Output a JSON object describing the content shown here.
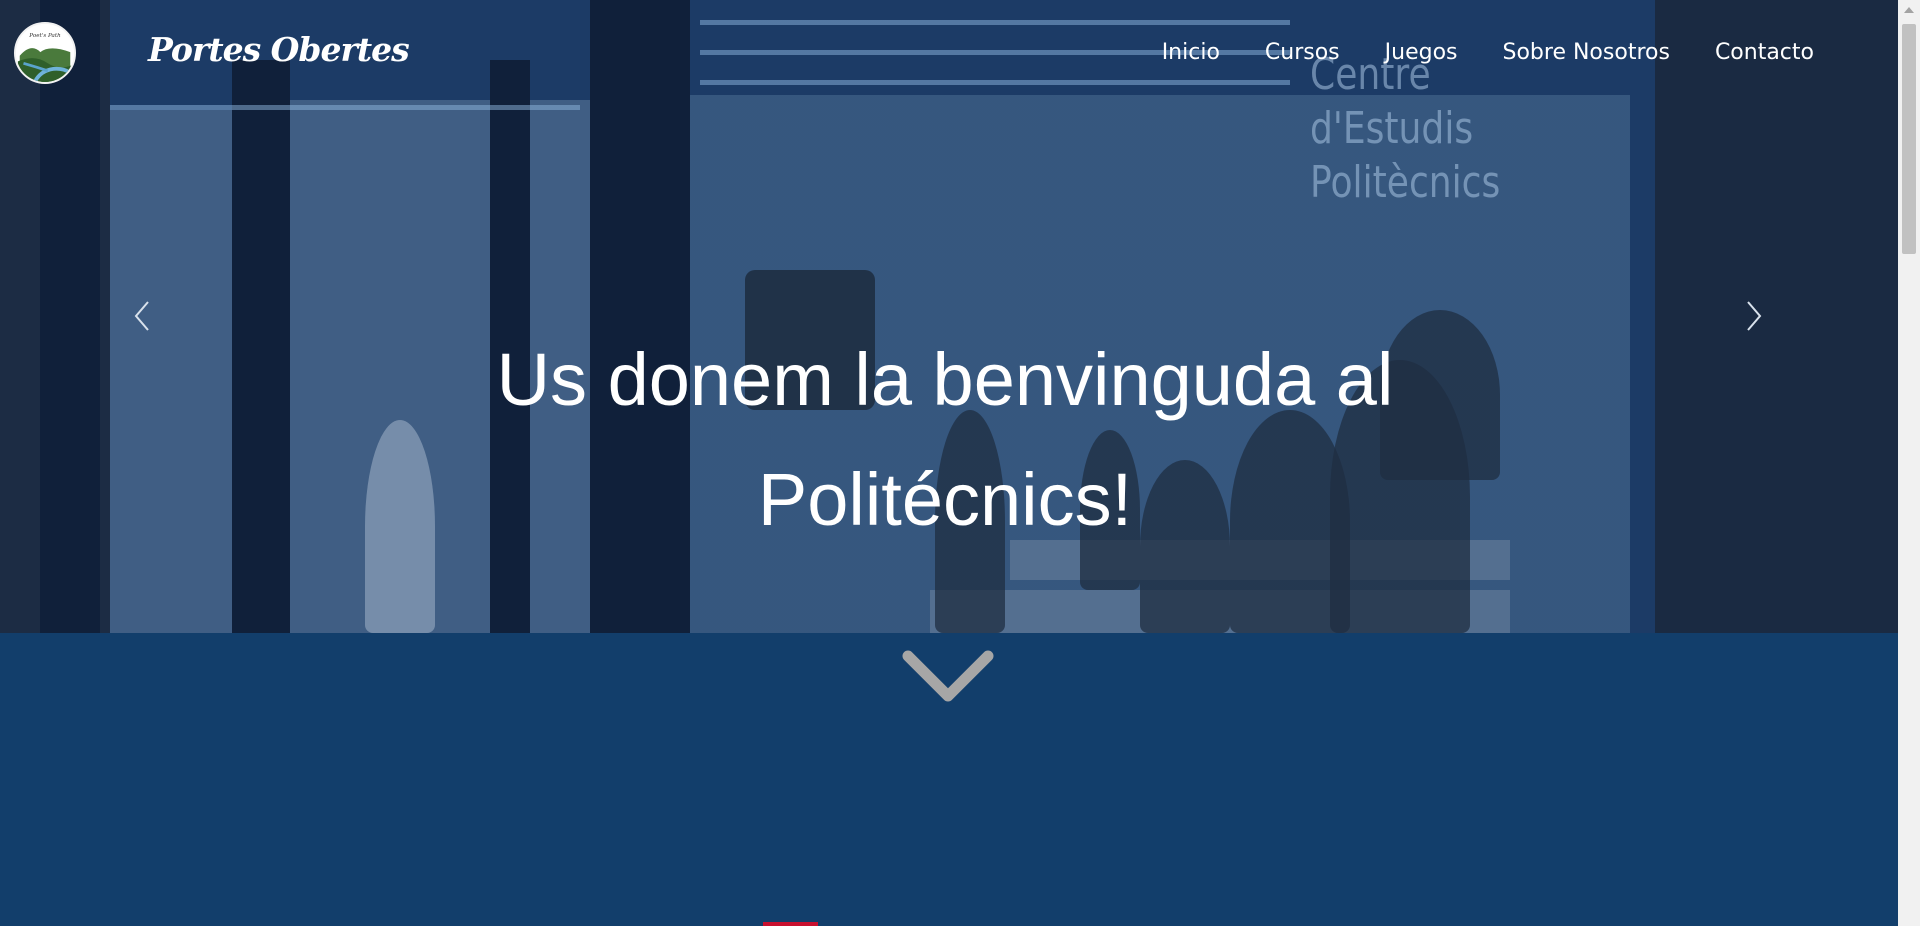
{
  "brand": {
    "name": "Portes Obertes",
    "logo_text": "Poet's Path"
  },
  "nav": {
    "items": [
      {
        "label": "Inicio"
      },
      {
        "label": "Cursos"
      },
      {
        "label": "Juegos"
      },
      {
        "label": "Sobre Nosotros"
      },
      {
        "label": "Contacto"
      }
    ]
  },
  "hero": {
    "title": "Us donem la benvinguda al Politécnics!",
    "background_sign": "Centre d'Estudis Politècnics",
    "prev_icon": "chevron-left-icon",
    "next_icon": "chevron-right-icon"
  },
  "section_below": {
    "scroll_icon": "chevron-down-icon"
  },
  "colors": {
    "primary_blue": "#123e6b",
    "hero_overlay": "#183a68",
    "text": "#ffffff",
    "chevron": "#a6a6a6",
    "accent_red": "#c8102e"
  }
}
